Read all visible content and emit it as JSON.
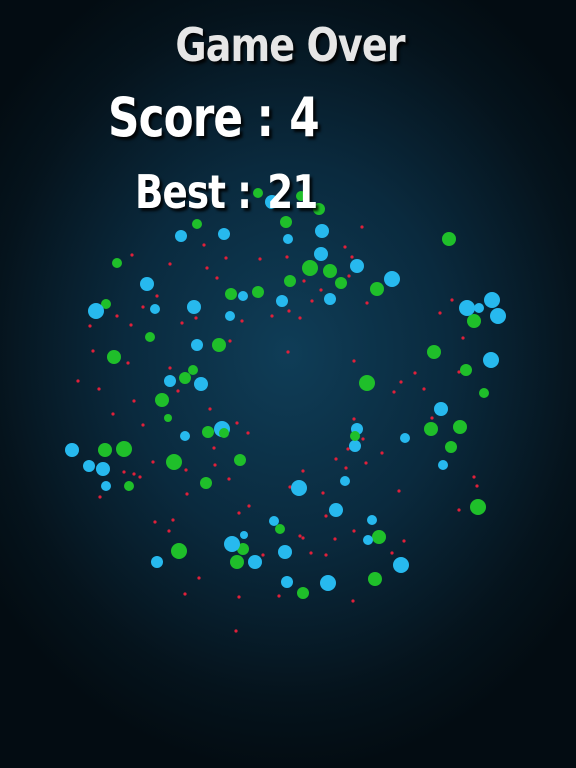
{
  "screen": {
    "title": "Game Over",
    "score_label": "Score :",
    "score_value": "4",
    "best_label": "Best :",
    "best_value": "21"
  },
  "colors": {
    "background_center": "#0f3d57",
    "background_edge": "#030c12",
    "text": "#ffffff",
    "particle_cyan": "#27b9ee",
    "particle_green": "#1fbf2a",
    "particle_red": "#e0203a"
  }
}
